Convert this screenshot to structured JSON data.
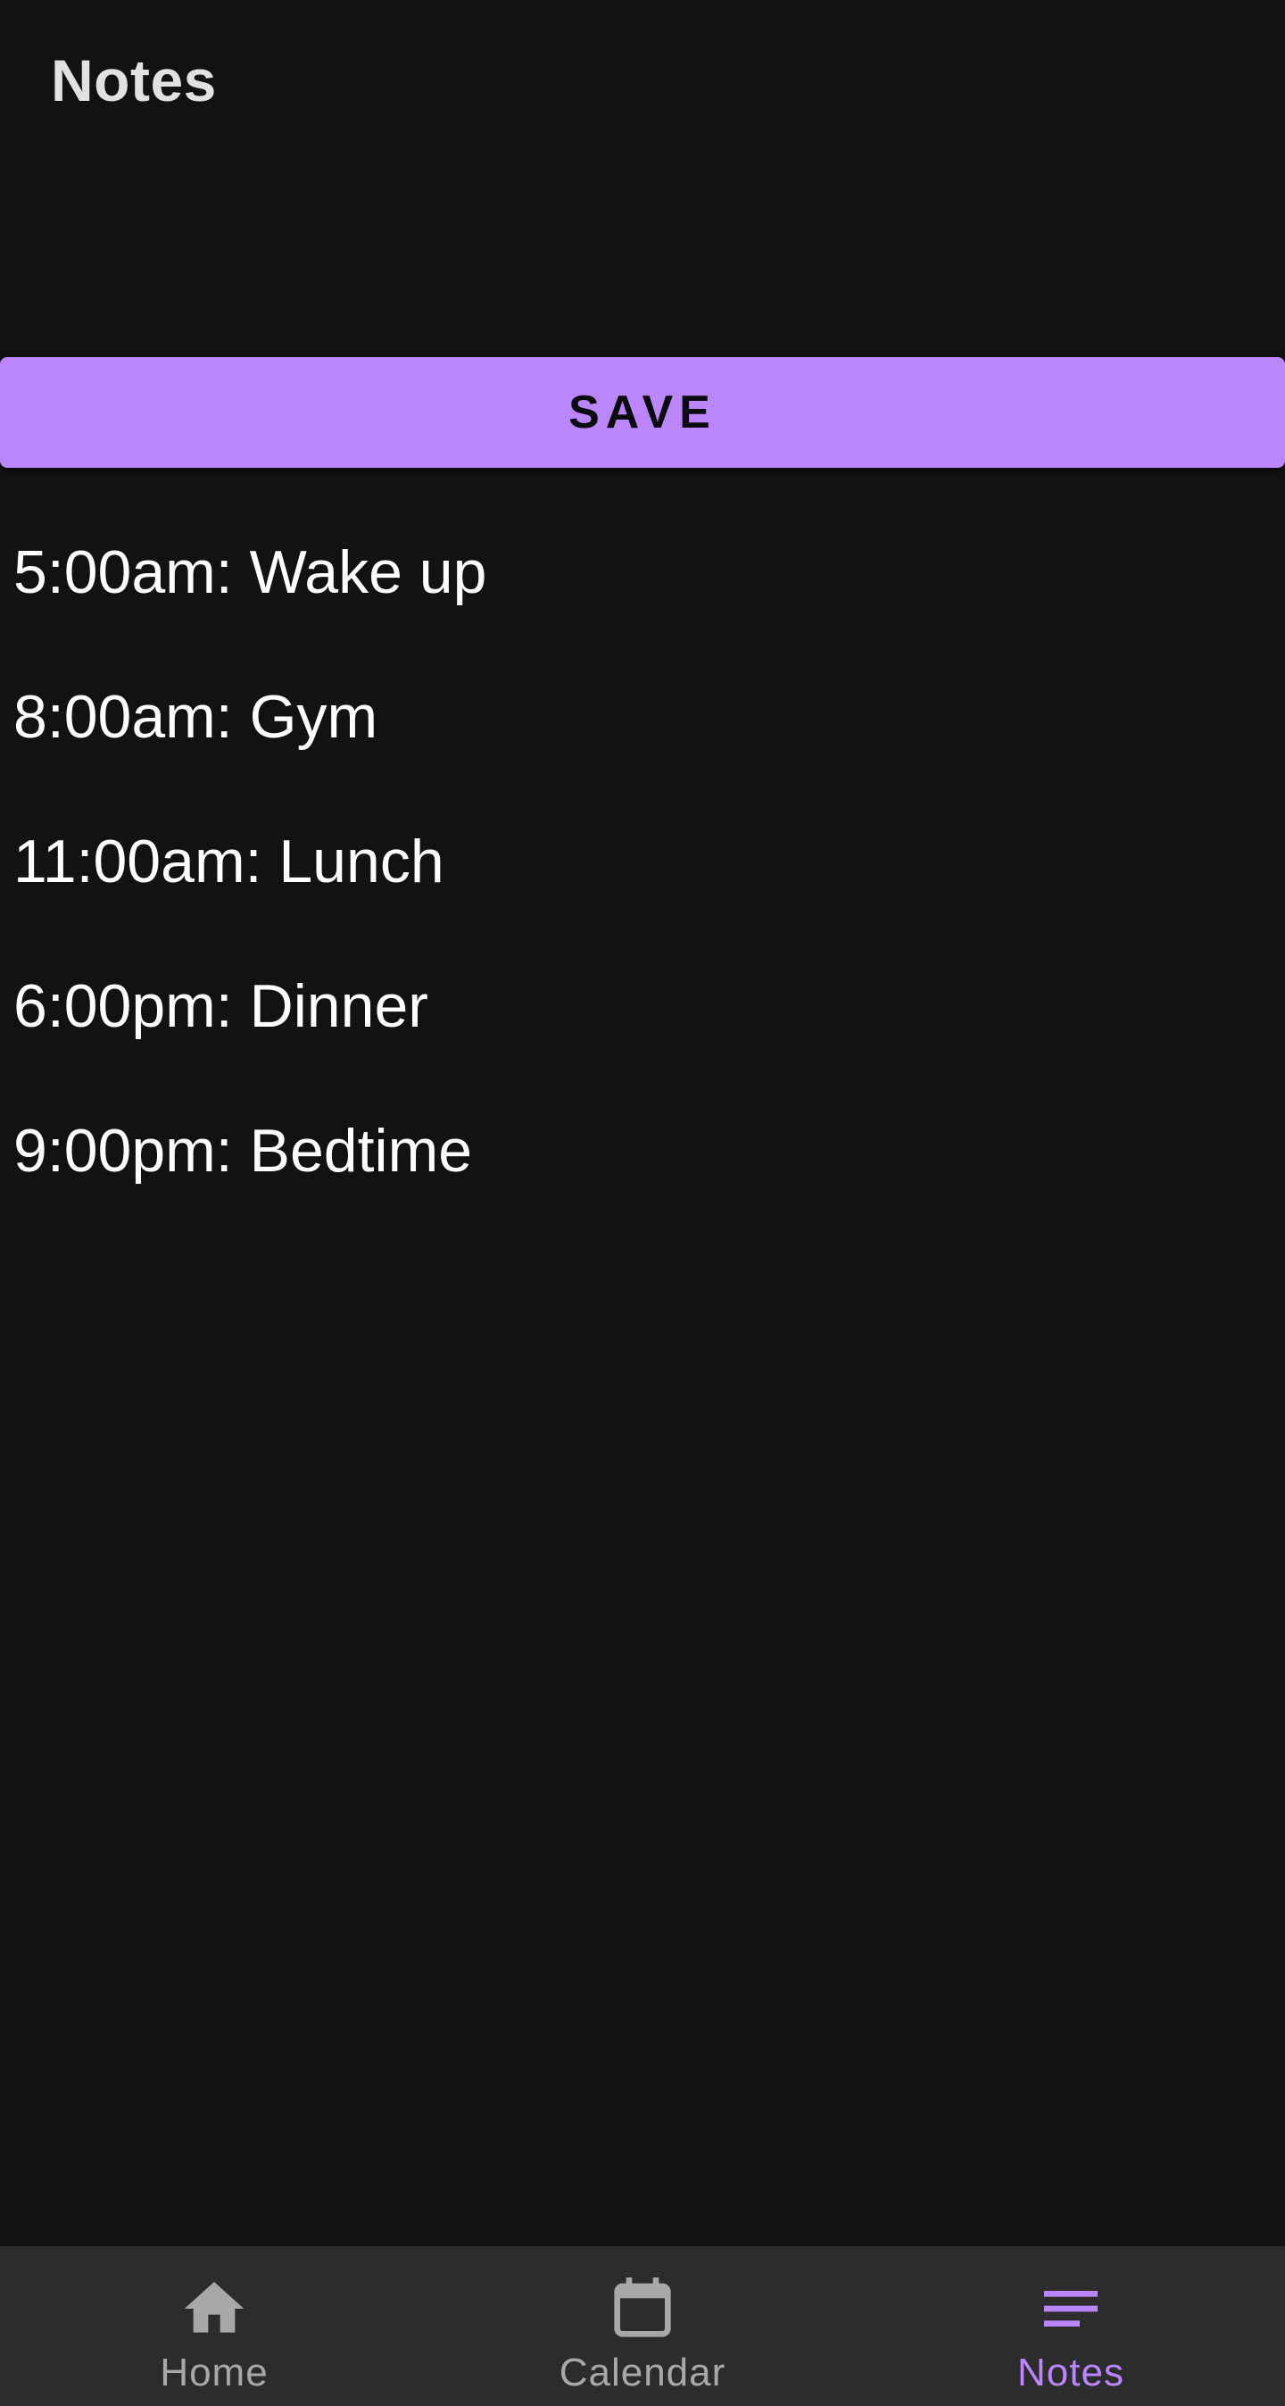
{
  "header": {
    "title": "Notes"
  },
  "actions": {
    "save_label": "SAVE"
  },
  "notes": [
    "5:00am: Wake up",
    "8:00am: Gym",
    "11:00am: Lunch",
    "6:00pm: Dinner",
    "9:00pm: Bedtime"
  ],
  "bottom_nav": {
    "items": [
      {
        "label": "Home",
        "icon": "home-icon",
        "active": false
      },
      {
        "label": "Calendar",
        "icon": "calendar-icon",
        "active": false
      },
      {
        "label": "Notes",
        "icon": "notes-icon",
        "active": true
      }
    ]
  },
  "colors": {
    "background": "#121212",
    "accent": "#bb86fc",
    "nav_background": "#2c2c2c",
    "nav_inactive": "#a8a8a8",
    "text": "#ffffff"
  }
}
